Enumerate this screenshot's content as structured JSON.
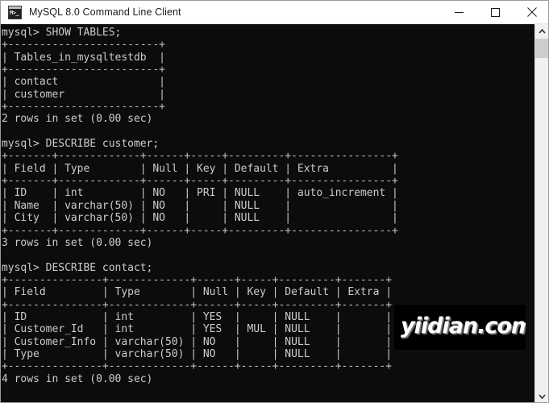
{
  "window": {
    "title": "MySQL 8.0 Command Line Client",
    "icon": "mysql-console-icon",
    "controls": {
      "minimize": "minimize-button",
      "maximize": "maximize-button",
      "close": "close-button"
    },
    "colors": {
      "titlebar_bg": "#ffffff",
      "console_bg": "#0c0c0c",
      "console_fg": "#cccccc",
      "separator_fg": "#b7c2cf",
      "scrollbar_bg": "#f0f0f0",
      "scrollbar_thumb": "#cdcdcd"
    }
  },
  "console": {
    "lines": [
      {
        "text": "mysql> SHOW TABLES;",
        "kind": "prompt"
      },
      {
        "text": "+------------------------+",
        "kind": "sep"
      },
      {
        "text": "| Tables_in_mysqltestdb  |",
        "kind": "text"
      },
      {
        "text": "+------------------------+",
        "kind": "sep"
      },
      {
        "text": "| contact                |",
        "kind": "text"
      },
      {
        "text": "| customer               |",
        "kind": "text"
      },
      {
        "text": "+------------------------+",
        "kind": "sep"
      },
      {
        "text": "2 rows in set (0.00 sec)",
        "kind": "text"
      },
      {
        "text": "",
        "kind": "blank"
      },
      {
        "text": "mysql> DESCRIBE customer;",
        "kind": "prompt"
      },
      {
        "text": "+-------+-------------+------+-----+---------+----------------+",
        "kind": "sep"
      },
      {
        "text": "| Field | Type        | Null | Key | Default | Extra          |",
        "kind": "text"
      },
      {
        "text": "+-------+-------------+------+-----+---------+----------------+",
        "kind": "sep"
      },
      {
        "text": "| ID    | int         | NO   | PRI | NULL    | auto_increment |",
        "kind": "text"
      },
      {
        "text": "| Name  | varchar(50) | NO   |     | NULL    |                |",
        "kind": "text"
      },
      {
        "text": "| City  | varchar(50) | NO   |     | NULL    |                |",
        "kind": "text"
      },
      {
        "text": "+-------+-------------+------+-----+---------+----------------+",
        "kind": "sep"
      },
      {
        "text": "3 rows in set (0.00 sec)",
        "kind": "text"
      },
      {
        "text": "",
        "kind": "blank"
      },
      {
        "text": "mysql> DESCRIBE contact;",
        "kind": "prompt"
      },
      {
        "text": "+---------------+-------------+------+-----+---------+-------+",
        "kind": "sep"
      },
      {
        "text": "| Field         | Type        | Null | Key | Default | Extra |",
        "kind": "text"
      },
      {
        "text": "+---------------+-------------+------+-----+---------+-------+",
        "kind": "sep"
      },
      {
        "text": "| ID            | int         | YES  |     | NULL    |       |",
        "kind": "text"
      },
      {
        "text": "| Customer_Id   | int         | YES  | MUL | NULL    |       |",
        "kind": "text"
      },
      {
        "text": "| Customer_Info | varchar(50) | NO   |     | NULL    |       |",
        "kind": "text"
      },
      {
        "text": "| Type          | varchar(50) | NO   |     | NULL    |       |",
        "kind": "text"
      },
      {
        "text": "+---------------+-------------+------+-----+---------+-------+",
        "kind": "sep"
      },
      {
        "text": "4 rows in set (0.00 sec)",
        "kind": "text"
      }
    ],
    "queries": [
      {
        "command": "SHOW TABLES;",
        "columns": [
          "Tables_in_mysqltestdb"
        ],
        "rows": [
          [
            "contact"
          ],
          [
            "customer"
          ]
        ],
        "status": "2 rows in set (0.00 sec)"
      },
      {
        "command": "DESCRIBE customer;",
        "columns": [
          "Field",
          "Type",
          "Null",
          "Key",
          "Default",
          "Extra"
        ],
        "rows": [
          [
            "ID",
            "int",
            "NO",
            "PRI",
            "NULL",
            "auto_increment"
          ],
          [
            "Name",
            "varchar(50)",
            "NO",
            "",
            "NULL",
            ""
          ],
          [
            "City",
            "varchar(50)",
            "NO",
            "",
            "NULL",
            ""
          ]
        ],
        "status": "3 rows in set (0.00 sec)"
      },
      {
        "command": "DESCRIBE contact;",
        "columns": [
          "Field",
          "Type",
          "Null",
          "Key",
          "Default",
          "Extra"
        ],
        "rows": [
          [
            "ID",
            "int",
            "YES",
            "",
            "NULL",
            ""
          ],
          [
            "Customer_Id",
            "int",
            "YES",
            "MUL",
            "NULL",
            ""
          ],
          [
            "Customer_Info",
            "varchar(50)",
            "NO",
            "",
            "NULL",
            ""
          ],
          [
            "Type",
            "varchar(50)",
            "NO",
            "",
            "NULL",
            ""
          ]
        ],
        "status": "4 rows in set (0.00 sec)"
      }
    ]
  },
  "watermark": {
    "text": "yiidian.com"
  },
  "scrollbar": {
    "up_arrow": "scroll-up-arrow",
    "down_arrow": "scroll-down-arrow",
    "thumb": "scroll-thumb"
  }
}
